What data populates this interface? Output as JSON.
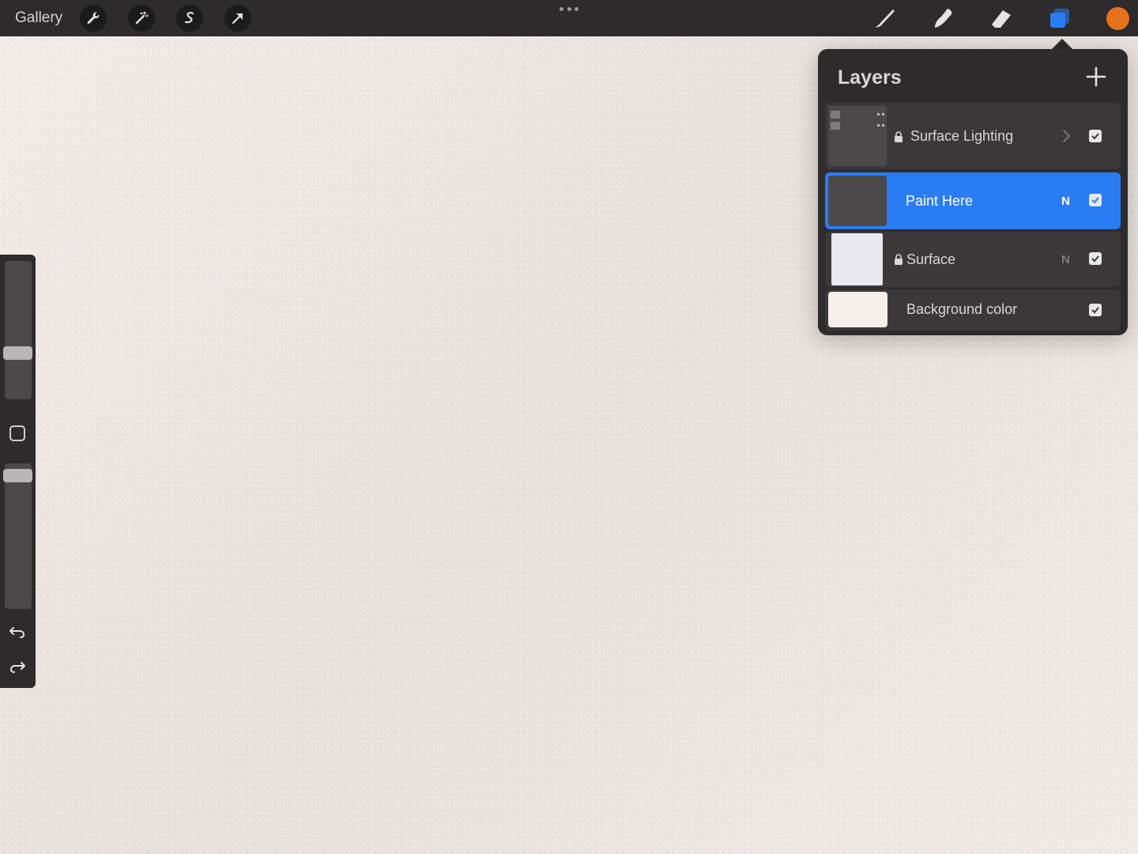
{
  "topbar": {
    "gallery_label": "Gallery",
    "tools_left": [
      "wrench-icon",
      "magic-wand-icon",
      "selection-icon",
      "transform-arrow-icon"
    ],
    "tools_right": [
      "brush-icon",
      "smudge-icon",
      "eraser-icon",
      "layers-icon"
    ],
    "active_tool": "layers-icon",
    "current_color": "#e8711c"
  },
  "sidebar": {
    "brush_size_level": 0.3,
    "opacity_level": 0.96,
    "undo": "undo-icon",
    "redo": "redo-icon"
  },
  "layers_panel": {
    "title": "Layers",
    "add_label": "+",
    "layers": [
      {
        "name": "Surface Lighting",
        "locked": true,
        "group": true,
        "blend": "",
        "visible": true,
        "thumb_color": "#4a4849"
      },
      {
        "name": "Paint Here",
        "locked": false,
        "group": false,
        "blend": "N",
        "visible": true,
        "active": true,
        "thumb_color": "#4a4849"
      },
      {
        "name": "Surface",
        "locked": true,
        "group": false,
        "blend": "N",
        "visible": true,
        "thumb_color": "#e9e8ee"
      },
      {
        "name": "Background color",
        "locked": false,
        "group": false,
        "blend": "",
        "visible": true,
        "thumb_color": "#f7efea"
      }
    ]
  },
  "colors": {
    "accent": "#2a7cf2",
    "chrome": "#2d2b2c",
    "canvas": "#efe8e5"
  }
}
